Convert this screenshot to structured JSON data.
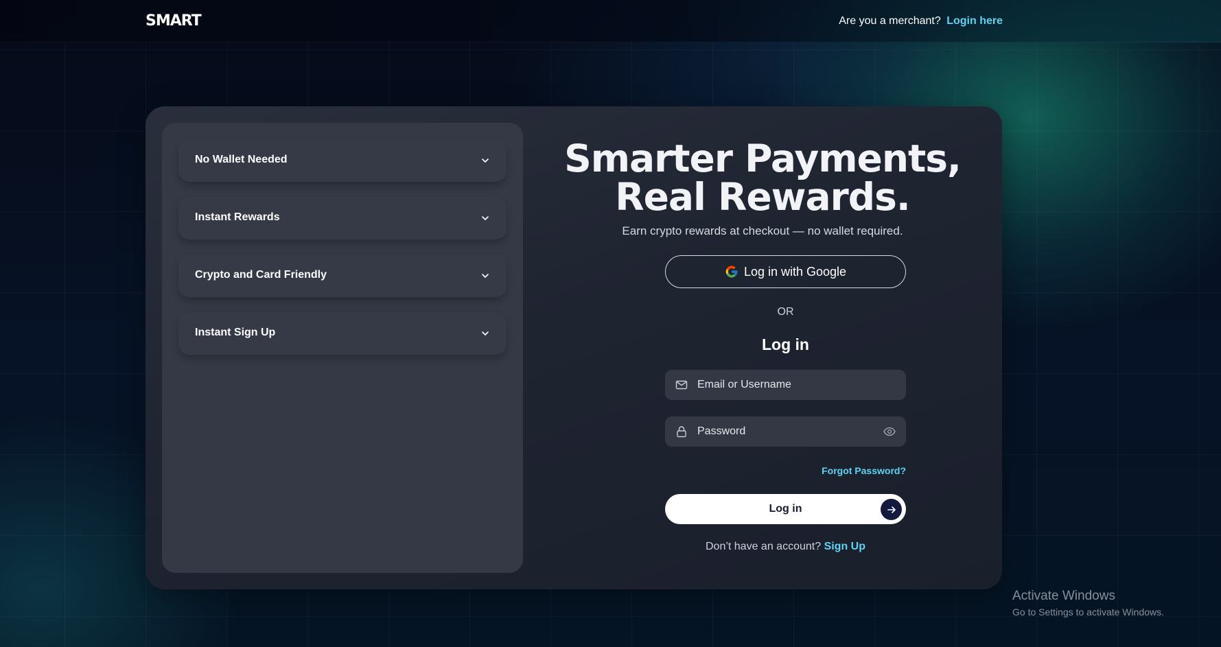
{
  "header": {
    "logo": "SMART",
    "merchant_prompt": "Are you a merchant?",
    "merchant_link": "Login here"
  },
  "features": {
    "items": [
      {
        "label": "No Wallet Needed",
        "icon": "chevron-down-icon"
      },
      {
        "label": "Instant Rewards",
        "icon": "chevron-down-icon"
      },
      {
        "label": "Crypto and Card Friendly",
        "icon": "chevron-down-icon"
      },
      {
        "label": "Instant Sign Up",
        "icon": "chevron-down-icon"
      }
    ]
  },
  "hero": {
    "headline_line1": "Smarter Payments,",
    "headline_line2": "Real Rewards.",
    "subtitle": "Earn crypto rewards at checkout — no wallet required."
  },
  "auth": {
    "google_button": "Log in with Google",
    "or_label": "OR",
    "title": "Log in",
    "email_placeholder": "Email or Username",
    "password_placeholder": "Password",
    "forgot_password": "Forgot Password?",
    "login_button": "Log in",
    "signup_prompt": "Don’t have an account?",
    "signup_link": "Sign Up"
  },
  "colors": {
    "accent": "#5fd3f3",
    "card_bg": "#1f2431",
    "panel_bg": "#353945",
    "button_arrow_bg": "#141a3e"
  },
  "os_watermark": {
    "title": "Activate Windows",
    "subtitle": "Go to Settings to activate Windows."
  }
}
